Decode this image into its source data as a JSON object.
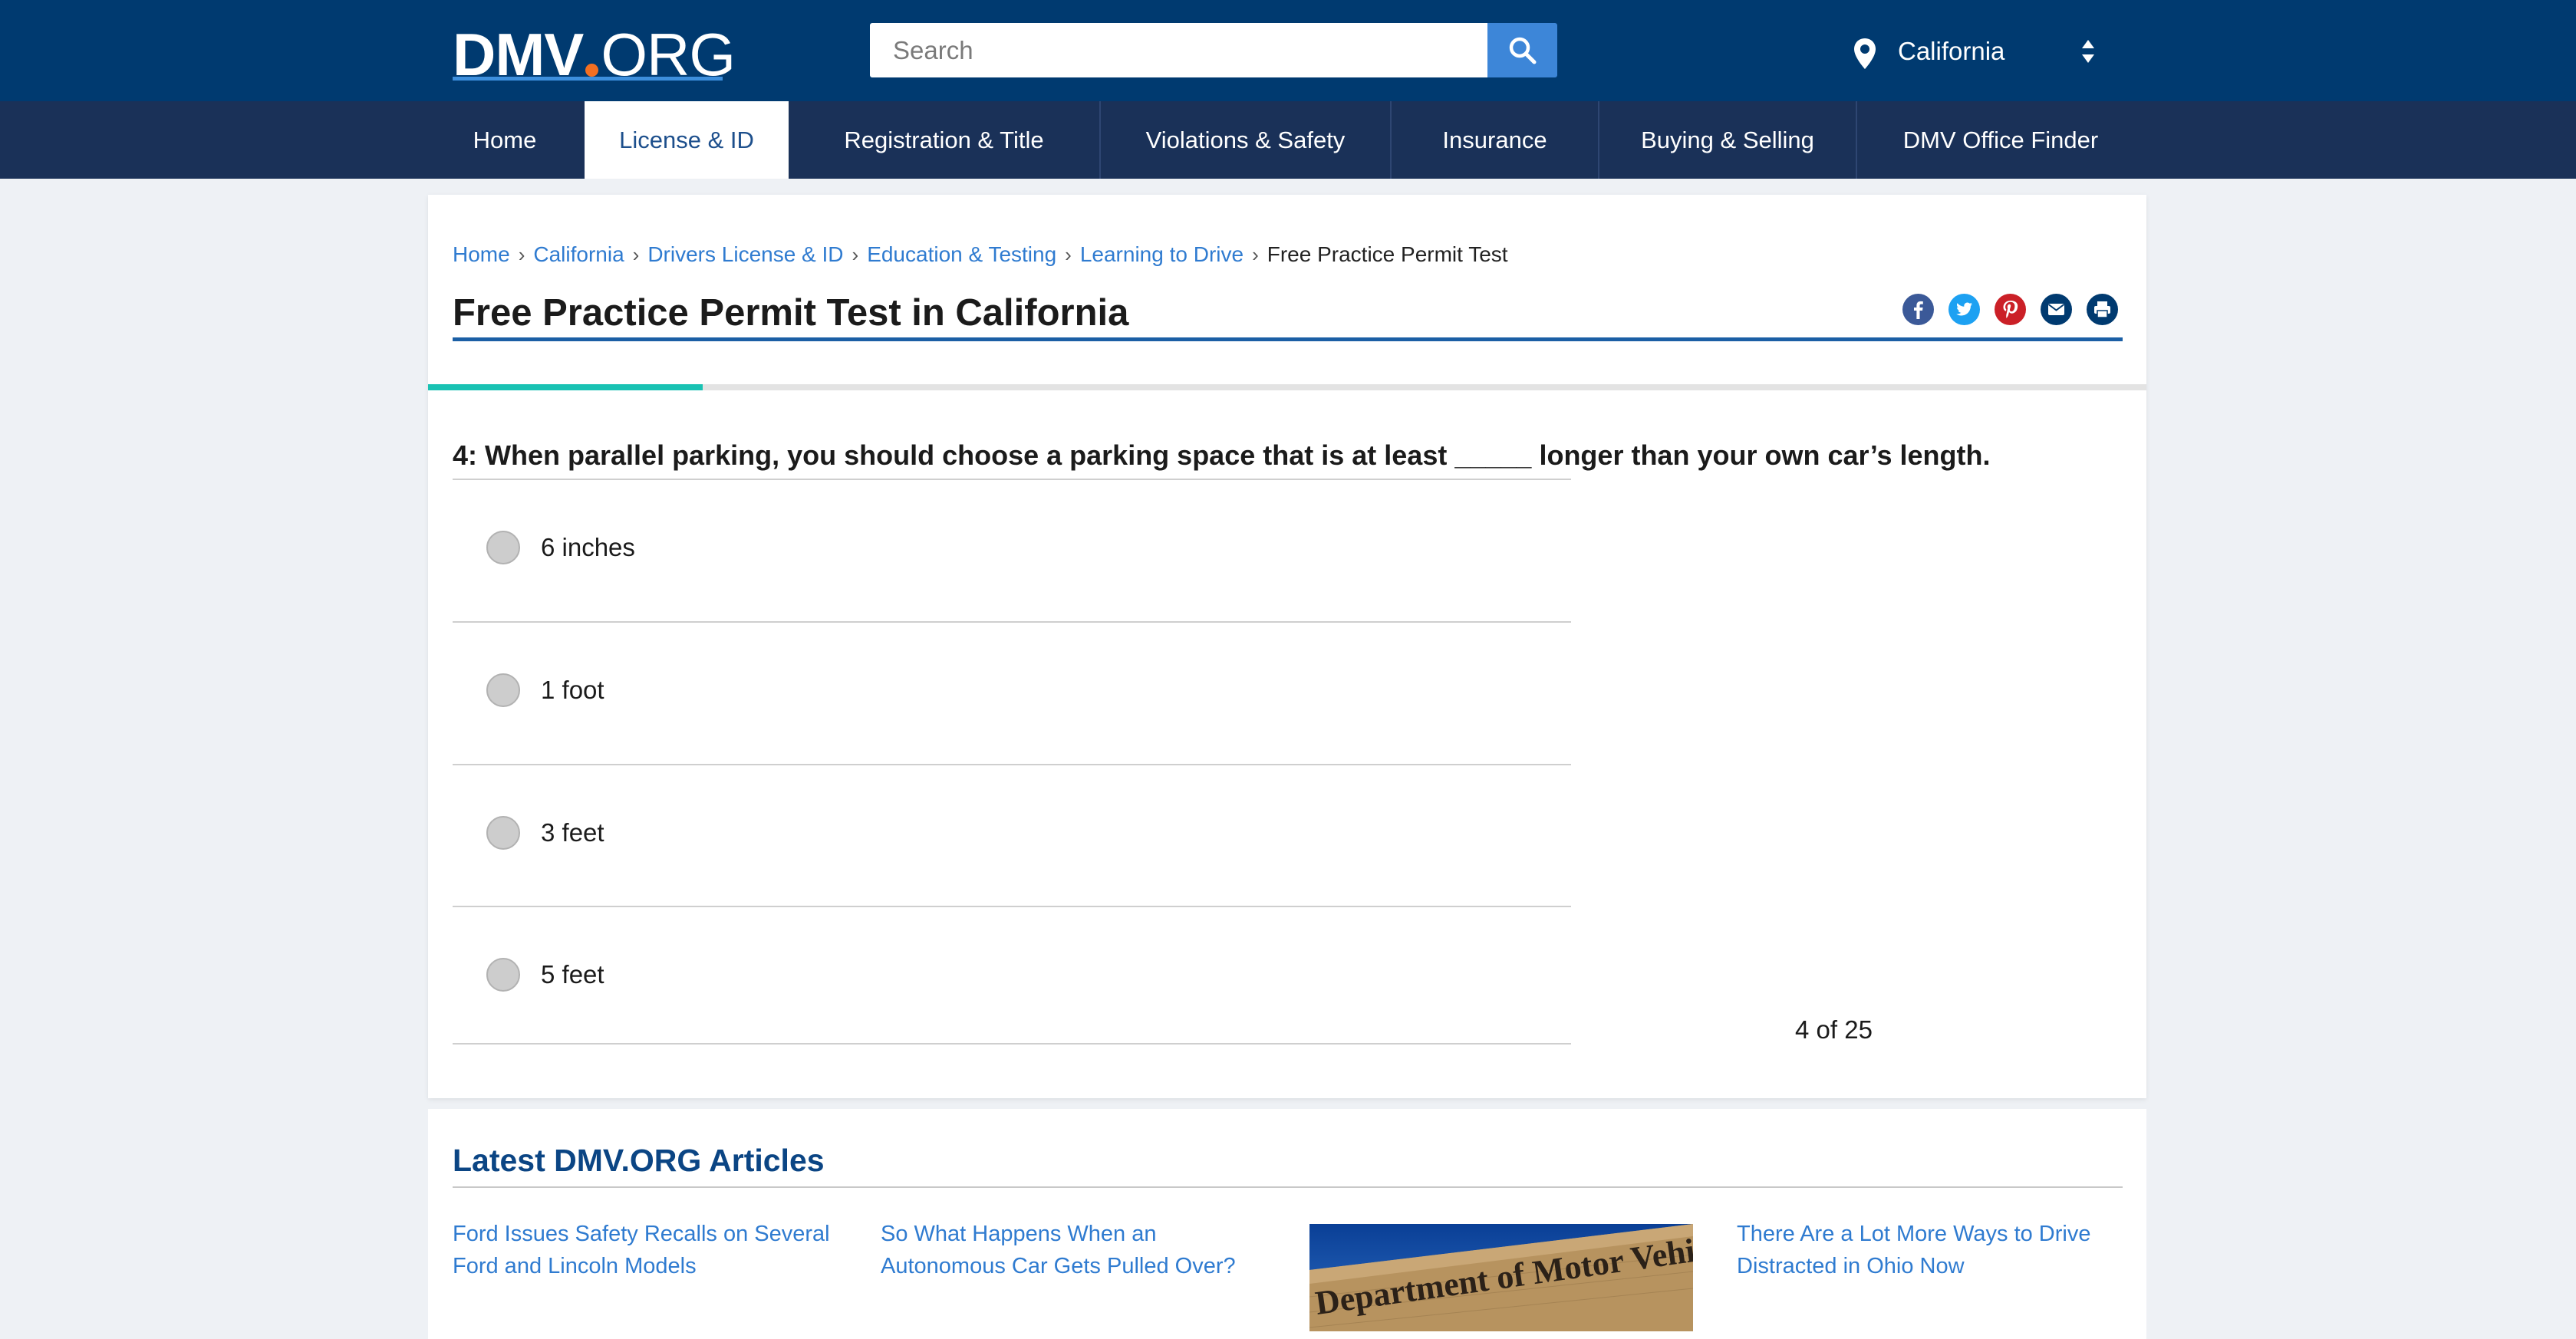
{
  "header": {
    "logo_bold": "DMV",
    "logo_light": "ORG",
    "search_placeholder": "Search",
    "location": "California"
  },
  "nav": {
    "items": [
      {
        "label": "Home"
      },
      {
        "label": "License & ID"
      },
      {
        "label": "Registration & Title"
      },
      {
        "label": "Violations & Safety"
      },
      {
        "label": "Insurance"
      },
      {
        "label": "Buying & Selling"
      },
      {
        "label": "DMV Office Finder"
      }
    ],
    "active": "License & ID"
  },
  "breadcrumb": [
    {
      "label": "Home"
    },
    {
      "label": "California"
    },
    {
      "label": "Drivers License & ID"
    },
    {
      "label": "Education & Testing"
    },
    {
      "label": "Learning to Drive"
    },
    {
      "label": "Free Practice Permit Test"
    }
  ],
  "page": {
    "title": "Free Practice Permit Test in California"
  },
  "share": {
    "icons": [
      "facebook-icon",
      "twitter-icon",
      "pinterest-icon",
      "email-icon",
      "print-icon"
    ],
    "colors": [
      "#3b5998",
      "#1da1f2",
      "#cb2027",
      "#003a70",
      "#003a70"
    ]
  },
  "quiz": {
    "progress_fraction": 0.16,
    "question": "4: When parallel parking, you should choose a parking space that is at least _____ longer than your own car’s length.",
    "answers": [
      {
        "label": "6 inches"
      },
      {
        "label": "1 foot"
      },
      {
        "label": "3 feet"
      },
      {
        "label": "5 feet"
      }
    ],
    "counter": "4 of 25"
  },
  "articles": {
    "heading": "Latest DMV.ORG Articles",
    "items": [
      {
        "line1": "Ford Issues Safety Recalls on Several",
        "line2": "Ford and Lincoln Models"
      },
      {
        "line1": "So What Happens When an",
        "line2": "Autonomous Car Gets Pulled Over?"
      },
      {
        "line1": "There Are a Lot More Ways to Drive",
        "line2": "Distracted in Ohio Now"
      }
    ],
    "image_sign_text": "Department of Motor Vehicles"
  },
  "colors": {
    "header_bg": "#003a70",
    "nav_bg": "#1a3158",
    "link": "#2f7bd0",
    "progress": "#19c2b3",
    "logo_dot": "#f36f21"
  }
}
